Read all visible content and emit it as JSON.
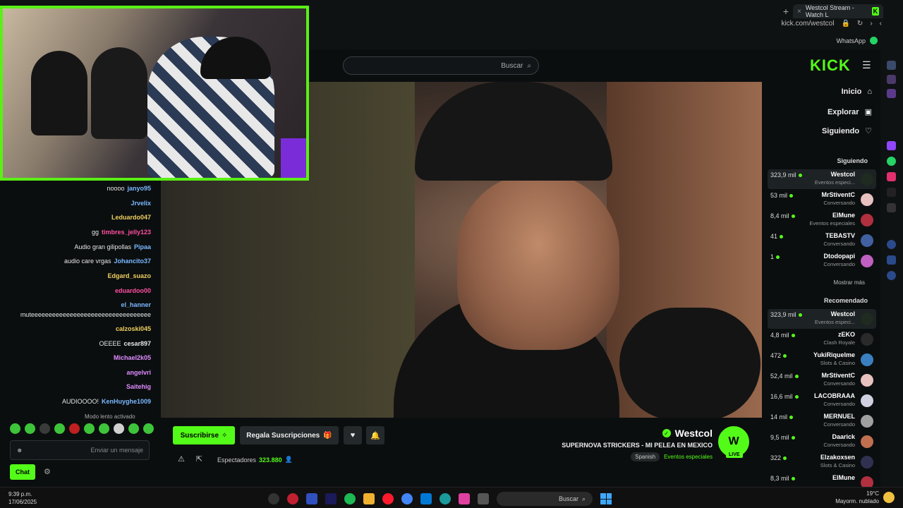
{
  "browser": {
    "tab_title": "Westcol Stream - Watch L",
    "url": "kick.com/westcol",
    "bookmark": "WhatsApp",
    "new_tab": "+",
    "tab_close": "×"
  },
  "header": {
    "search_placeholder": "Buscar",
    "logo": "KICK"
  },
  "nav": {
    "items": [
      {
        "label": "Inicio",
        "icon": "home-icon"
      },
      {
        "label": "Explorar",
        "icon": "explore-icon"
      },
      {
        "label": "Siguiendo",
        "icon": "heart-icon"
      }
    ]
  },
  "following": {
    "title": "Siguiendo",
    "show_more": "Mostrar más",
    "channels": [
      {
        "name": "Westcol",
        "category": "Eventos especi...",
        "viewers": "323,9 mil",
        "color": "#1f2a20"
      },
      {
        "name": "MrStiventC",
        "category": "Conversando",
        "viewers": "53 mil",
        "color": "#e8c0c0"
      },
      {
        "name": "ElMune",
        "category": "Eventos especiales",
        "viewers": "8,4 mil",
        "color": "#b03040"
      },
      {
        "name": "TEBASTV",
        "category": "Conversando",
        "viewers": "41",
        "color": "#4060a0"
      },
      {
        "name": "Dtodopapi",
        "category": "Conversando",
        "viewers": "1",
        "color": "#c060c0"
      }
    ]
  },
  "recommended": {
    "title": "Recomendado",
    "channels": [
      {
        "name": "Westcol",
        "category": "Eventos especi...",
        "viewers": "323,9 mil",
        "color": "#1f2a20"
      },
      {
        "name": "zEKO",
        "category": "Clash Royale",
        "viewers": "4,8 mil",
        "color": "#2a2a2a"
      },
      {
        "name": "YukiRiquelme",
        "category": "Slots & Casino",
        "viewers": "472",
        "color": "#3a80c0"
      },
      {
        "name": "MrStiventC",
        "category": "Conversando",
        "viewers": "52,4 mil",
        "color": "#e8c0c0"
      },
      {
        "name": "LACOBRAAA",
        "category": "Conversando",
        "viewers": "16,6 mil",
        "color": "#d0d0e0"
      },
      {
        "name": "MERNUEL",
        "category": "Conversando",
        "viewers": "14 mil",
        "color": "#a0a0a0"
      },
      {
        "name": "Daarick",
        "category": "Conversando",
        "viewers": "9,5 mil",
        "color": "#c07050"
      },
      {
        "name": "Elzakoxsen",
        "category": "Slots & Casino",
        "viewers": "322",
        "color": "#303050"
      },
      {
        "name": "ElMune",
        "category": "",
        "viewers": "8,3 mil",
        "color": "#b03040"
      }
    ]
  },
  "chat": {
    "messages": [
      {
        "user": "janyo95",
        "text": "noooo",
        "color": "#7ab8ff"
      },
      {
        "user": "Jrvelix",
        "text": "",
        "color": "#7ab8ff"
      },
      {
        "user": "Leduardo047",
        "text": "",
        "color": "#f0d060"
      },
      {
        "user": "timbres_jelly123",
        "text": "gg",
        "color": "#ff4fa0"
      },
      {
        "user": "Pipaa",
        "text": "Audio gran gilipollas",
        "color": "#7ab8ff"
      },
      {
        "user": "Johancito37",
        "text": "audio care vrgas",
        "color": "#7ab8ff"
      },
      {
        "user": "Edgard_suazo",
        "text": "",
        "color": "#f0d060"
      },
      {
        "user": "eduardoo00",
        "text": "",
        "color": "#ff4fa0"
      },
      {
        "user": "el_hanner",
        "text": "",
        "color": "#7ab8ff"
      },
      {
        "user": "",
        "text": "muteeeeeeeeeeeeeeeeeeeeeeeeeeeeeeeeee",
        "color": "#e6e6e6"
      },
      {
        "user": "calzoski045",
        "text": "",
        "color": "#f0d060"
      },
      {
        "user": "cesar897",
        "text": "OEEEE",
        "color": "#e6e6e6"
      },
      {
        "user": "Michael2k05",
        "text": "",
        "color": "#e08cff"
      },
      {
        "user": "angelvri",
        "text": "",
        "color": "#e08cff"
      },
      {
        "user": "Saitehig",
        "text": "",
        "color": "#e08cff"
      },
      {
        "user": "KenHuyghe1009",
        "text": "AUDIOOOO!",
        "color": "#7ab8ff"
      }
    ],
    "slow_mode": "Modo lento activado",
    "input_placeholder": "Enviar un mensaje",
    "send_label": "Chat"
  },
  "stream": {
    "streamer": "Westcol",
    "title": "SUPERNOVA STRICKERS - MI PELEA EN MEXICO",
    "category": "Eventos especiales",
    "language": "Spanish",
    "viewers": "323.880",
    "viewers_label": "Espectadores",
    "live_badge": "LIVE",
    "subscribe_label": "Suscribirse",
    "gift_label": "Regala Suscripciones"
  },
  "taskbar": {
    "time": "9:39 p.m.",
    "date": "17/06/2025",
    "search_placeholder": "Buscar",
    "weather_temp": "19°C",
    "weather_desc": "Mayorm. nublado"
  },
  "colors": {
    "accent": "#53fc18",
    "background": "#0b0e0f"
  }
}
